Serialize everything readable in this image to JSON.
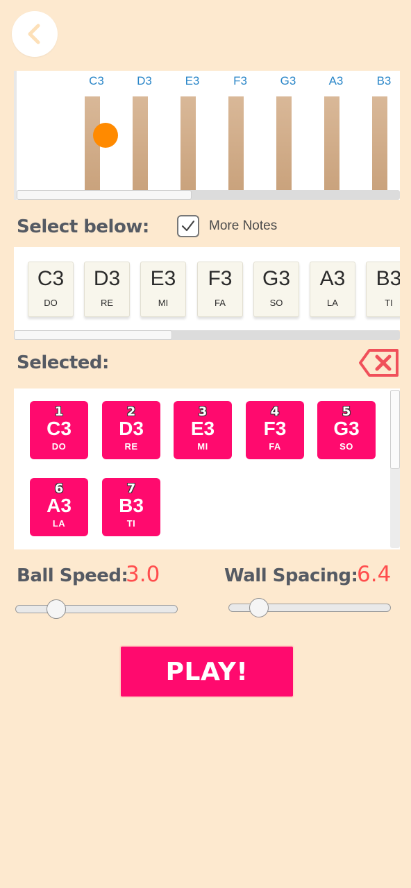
{
  "preview": {
    "labels": [
      "C3",
      "D3",
      "E3",
      "F3",
      "G3",
      "A3",
      "B3"
    ]
  },
  "select_title": "Select below:",
  "more_notes": {
    "label": "More Notes",
    "checked": true
  },
  "available_notes": [
    {
      "note": "C3",
      "solfege": "DO"
    },
    {
      "note": "D3",
      "solfege": "RE"
    },
    {
      "note": "E3",
      "solfege": "MI"
    },
    {
      "note": "F3",
      "solfege": "FA"
    },
    {
      "note": "G3",
      "solfege": "SO"
    },
    {
      "note": "A3",
      "solfege": "LA"
    },
    {
      "note": "B3",
      "solfege": "TI"
    }
  ],
  "selected_title": "Selected:",
  "selected_notes": [
    {
      "index": "1",
      "note": "C3",
      "solfege": "DO"
    },
    {
      "index": "2",
      "note": "D3",
      "solfege": "RE"
    },
    {
      "index": "3",
      "note": "E3",
      "solfege": "MI"
    },
    {
      "index": "4",
      "note": "F3",
      "solfege": "FA"
    },
    {
      "index": "5",
      "note": "G3",
      "solfege": "SO"
    },
    {
      "index": "6",
      "note": "A3",
      "solfege": "LA"
    },
    {
      "index": "7",
      "note": "B3",
      "solfege": "TI"
    }
  ],
  "ball_speed": {
    "label": "Ball Speed:",
    "value": "3.0"
  },
  "wall_spacing": {
    "label": "Wall Spacing:",
    "value": "6.4"
  },
  "play_label": "PLAY!",
  "colors": {
    "background": "#fde9cf",
    "accent": "#ff0a6e",
    "ball": "#ff8a00",
    "note_label": "#2a86c8",
    "value_text": "#ff4d4d"
  }
}
